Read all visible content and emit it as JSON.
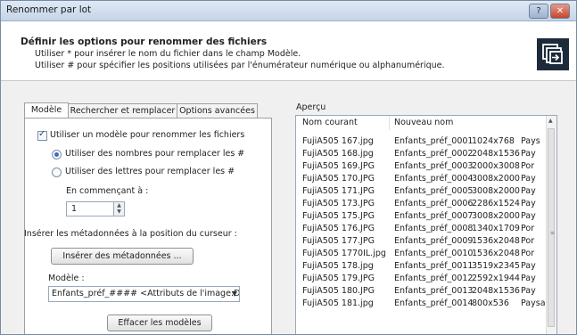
{
  "window": {
    "title": "Renommer par lot",
    "help_label": "?",
    "close_label": "✕"
  },
  "header": {
    "title": "Définir les options pour renommer des fichiers",
    "line1": "Utiliser * pour insérer le nom du fichier dans le champ Modèle.",
    "line2": "Utiliser # pour spécifier les positions utilisées par l'énumérateur numérique ou alphanumérique."
  },
  "tabs": [
    "Modèle",
    "Rechercher et remplacer",
    "Options avancées"
  ],
  "panel": {
    "use_model_label": "Utiliser un modèle pour renommer les fichiers",
    "use_model_checked": true,
    "radio_numbers_label": "Utiliser des nombres pour remplacer les #",
    "radio_letters_label": "Utiliser des lettres pour remplacer les #",
    "selected_radio": "numbers",
    "start_label": "En commençant à :",
    "start_value": "1",
    "insert_meta_label": "Insérer les métadonnées à la position du curseur :",
    "insert_meta_button": "Insérer des métadonnées ...",
    "model_label": "Modèle :",
    "model_value": "Enfants_préf_#### <Attributs de l'image:Dim",
    "clear_button": "Effacer les modèles"
  },
  "preview": {
    "label": "Aperçu",
    "columns": [
      "Nom courant",
      "Nouveau nom"
    ],
    "rows": [
      [
        "FujiA505 167.jpg",
        "Enfants_préf_0001",
        "1024x768",
        "Pays"
      ],
      [
        "FujiA505 168.jpg",
        "Enfants_préf_0002",
        "2048x1536",
        "Pay"
      ],
      [
        "FujiA505 169.JPG",
        "Enfants_préf_0003",
        "2000x3008",
        "Por"
      ],
      [
        "FujiA505 170.JPG",
        "Enfants_préf_0004",
        "3008x2000",
        "Pay"
      ],
      [
        "FujiA505 171.JPG",
        "Enfants_préf_0005",
        "3008x2000",
        "Pay"
      ],
      [
        "FujiA505 173.JPG",
        "Enfants_préf_0006",
        "2286x1524",
        "Pay"
      ],
      [
        "FujiA505 175.JPG",
        "Enfants_préf_0007",
        "3008x2000",
        "Pay"
      ],
      [
        "FujiA505 176.JPG",
        "Enfants_préf_0008",
        "1340x1709",
        "Por"
      ],
      [
        "FujiA505 177.JPG",
        "Enfants_préf_0009",
        "1536x2048",
        "Por"
      ],
      [
        "FujiA505 1770IL.jpg",
        "Enfants_préf_0010",
        "1536x2048",
        "Por"
      ],
      [
        "FujiA505 178.jpg",
        "Enfants_préf_0011",
        "3519x2345",
        "Pay"
      ],
      [
        "FujiA505 179.JPG",
        "Enfants_préf_0012",
        "2592x1944",
        "Pay"
      ],
      [
        "FujiA505 180.JPG",
        "Enfants_préf_0013",
        "2048x1536",
        "Pay"
      ],
      [
        "FujiA505 181.jpg",
        "Enfants_préf_0014",
        "800x536",
        "Paysa"
      ]
    ]
  },
  "icons": {
    "help": "question-icon",
    "close": "close-icon",
    "header": "batch-rename-icon",
    "check": "checkmark-icon",
    "spin_up": "arrow-up-icon",
    "spin_down": "arrow-down-icon",
    "dropdown": "chevron-down-icon",
    "scroll_up": "arrow-up-icon",
    "scroll_grip": "grip-icon"
  },
  "colors": {
    "title_bar": "#c4d4e8",
    "close_button": "#c6462f",
    "header_icon_bg": "#1d2a3a"
  }
}
